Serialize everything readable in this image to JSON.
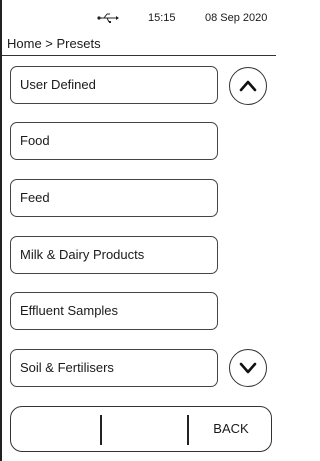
{
  "status_bar": {
    "time": "15:15",
    "date": "08 Sep 2020",
    "usb_icon": "usb-icon"
  },
  "breadcrumb": "Home > Presets",
  "presets": [
    {
      "label": "User Defined"
    },
    {
      "label": "Food"
    },
    {
      "label": "Feed"
    },
    {
      "label": "Milk & Dairy Products"
    },
    {
      "label": "Effluent Samples"
    },
    {
      "label": "Soil & Fertilisers"
    }
  ],
  "scroll": {
    "up_icon": "chevron-up-icon",
    "down_icon": "chevron-down-icon"
  },
  "footer": {
    "back_label": "BACK"
  }
}
